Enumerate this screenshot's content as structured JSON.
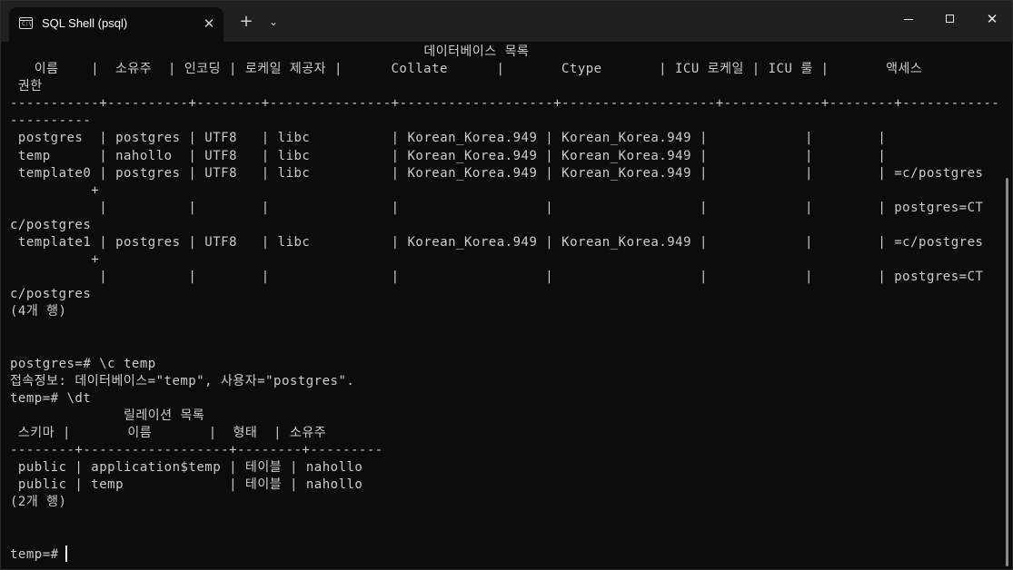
{
  "window": {
    "tab_title": "SQL Shell (psql)",
    "tab_icon": "terminal-icon",
    "close_tab_glyph": "✕",
    "new_tab_glyph": "+",
    "dropdown_glyph": "⌄",
    "minimize_glyph": "",
    "maximize_glyph": "",
    "close_glyph": "✕"
  },
  "terminal": {
    "lines": [
      "                                                   데이터베이스 목록",
      "   이름    |  소유주  | 인코딩 | 로케일 제공자 |      Collate      |       Ctype       | ICU 로케일 | ICU 룰 |       액세스",
      " 권한",
      "-----------+----------+--------+---------------+-------------------+-------------------+------------+--------+-----------------",
      "----------",
      " postgres  | postgres | UTF8   | libc          | Korean_Korea.949 | Korean_Korea.949 |            |        |",
      " temp      | nahollo  | UTF8   | libc          | Korean_Korea.949 | Korean_Korea.949 |            |        |",
      " template0 | postgres | UTF8   | libc          | Korean_Korea.949 | Korean_Korea.949 |            |        | =c/postgres",
      "          +",
      "           |          |        |               |                  |                  |            |        | postgres=CT",
      "c/postgres",
      " template1 | postgres | UTF8   | libc          | Korean_Korea.949 | Korean_Korea.949 |            |        | =c/postgres",
      "          +",
      "           |          |        |               |                  |                  |            |        | postgres=CT",
      "c/postgres",
      "(4개 행)",
      "",
      "",
      "postgres=# \\c temp",
      "접속정보: 데이터베이스=\"temp\", 사용자=\"postgres\".",
      "temp=# \\dt",
      "              릴레이션 목록",
      " 스키마 |       이름       |  형태  | 소유주",
      "--------+------------------+--------+---------",
      " public | application$temp | 테이블 | nahollo",
      " public | temp             | 테이블 | nahollo",
      "(2개 행)",
      "",
      "",
      "temp=# "
    ]
  }
}
